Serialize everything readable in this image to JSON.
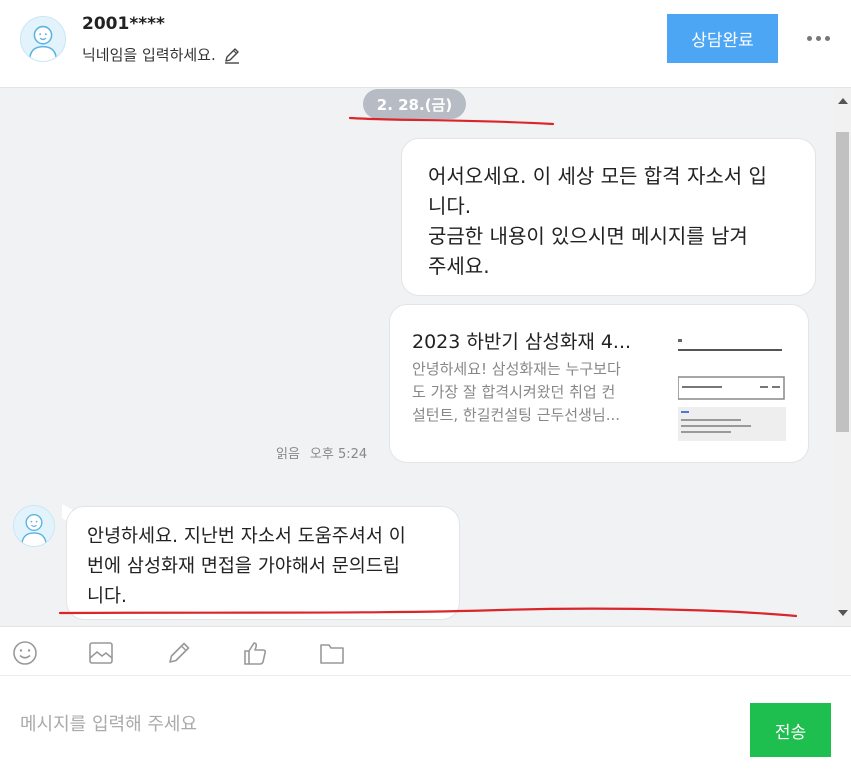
{
  "header": {
    "user_name": "2001****",
    "nickname_placeholder": "닉네임을 입력하세요.",
    "done_button_label": "상담완료",
    "avatar_icon": "user-avatar-icon",
    "edit_icon": "pencil-icon",
    "more_icon": "more-dots-icon"
  },
  "chat": {
    "date_label": "2. 28.(금)",
    "messages": [
      {
        "direction": "outgoing",
        "lines": [
          "어서오세요. 이 세상 모든 합격 자소서 입",
          "니다.",
          "궁금한 내용이 있으시면 메시지를 남겨",
          "주세요."
        ]
      },
      {
        "direction": "outgoing",
        "type": "link-card",
        "title": "2023 하반기 삼성화재 4...",
        "description_lines": [
          "안녕하세요! 삼성화재는 누구보다",
          "도 가장 잘 합격시켜왔던 취업 컨",
          "설턴트, 한길컨설팅 근두선생님..."
        ],
        "read_label": "읽음",
        "time": "오후 5:24"
      },
      {
        "direction": "incoming",
        "lines": [
          "안녕하세요. 지난번 자소서 도움주셔서 이",
          "번에 삼성화재 면접을 가야해서 문의드립",
          "니다."
        ]
      }
    ]
  },
  "toolbar": {
    "icons": [
      "emoji-icon",
      "image-icon",
      "pencil-icon",
      "thumbs-up-icon",
      "folder-icon"
    ]
  },
  "composer": {
    "placeholder": "메시지를 입력해 주세요",
    "value": "",
    "send_label": "전송"
  },
  "colors": {
    "accent_blue": "#4da6f3",
    "send_green": "#1fbf4f",
    "chat_background": "#f1f2f4",
    "date_pill": "#b7bcc4",
    "annotation_red": "#d9262b"
  }
}
